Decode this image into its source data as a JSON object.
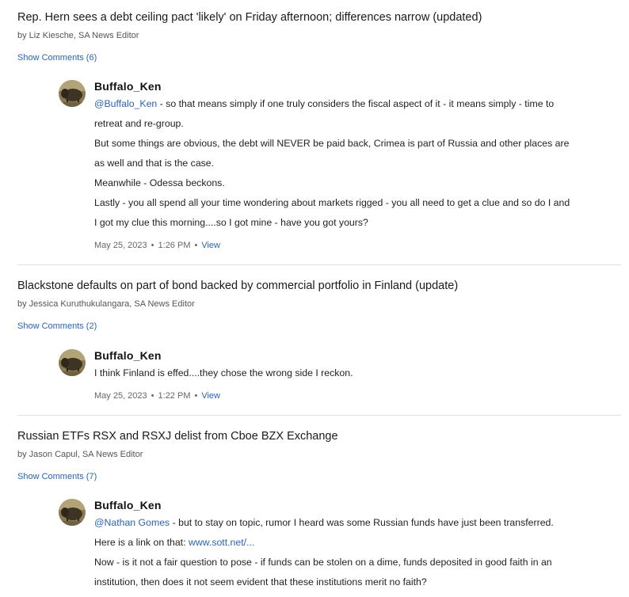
{
  "articles": [
    {
      "title": "Rep. Hern sees a debt ceiling pact 'likely' on Friday afternoon; differences narrow (updated)",
      "byline": "by Liz Kiesche, SA News Editor",
      "show_comments": "Show Comments (6)",
      "comment": {
        "author": "Buffalo_Ken",
        "mention": "@Buffalo_Ken",
        "first_line_rest": " - so that means simply if one truly considers the fiscal aspect of it - it means simply - time to",
        "lines": [
          "retreat and re-group.",
          "But some things are obvious, the debt will NEVER be paid back, Crimea is part of Russia and other places are",
          "as well and that is the case.",
          "Meanwhile - Odessa beckons.",
          "Lastly - you all spend all your time wondering about markets rigged - you all need to get a clue and so do I and",
          "I got my clue this morning....so I got mine - have you got yours?"
        ],
        "date": "May 25, 2023",
        "time": "1:26 PM",
        "view": "View"
      }
    },
    {
      "title": "Blackstone defaults on part of bond backed by commercial portfolio in Finland (update)",
      "byline": "by Jessica Kuruthukulangara, SA News Editor",
      "show_comments": "Show Comments (2)",
      "comment": {
        "author": "Buffalo_Ken",
        "lines": [
          "I think Finland is effed....they chose the wrong side I reckon."
        ],
        "date": "May 25, 2023",
        "time": "1:22 PM",
        "view": "View"
      }
    },
    {
      "title": "Russian ETFs RSX and RSXJ delist from Cboe BZX Exchange",
      "byline": "by Jason Capul, SA News Editor",
      "show_comments": "Show Comments (7)",
      "comment": {
        "author": "Buffalo_Ken",
        "mention": "@Nathan Gomes",
        "first_line_rest": " - but to stay on topic, rumor I heard was some Russian funds have just been transferred.",
        "link_prefix": "Here is a link on that: ",
        "link_text": "www.sott.net/...",
        "lines": [
          "Now - is it not a fair question to pose - if funds can be stolen on a dime, funds deposited in good faith in an",
          "institution, then does it not seem evident that these institutions merit no faith?"
        ]
      }
    }
  ],
  "meta_separator": "•",
  "colors": {
    "link": "#2b63b4",
    "divider": "#e0e0e0"
  },
  "icons": {
    "avatar": "buffalo-avatar-icon"
  }
}
